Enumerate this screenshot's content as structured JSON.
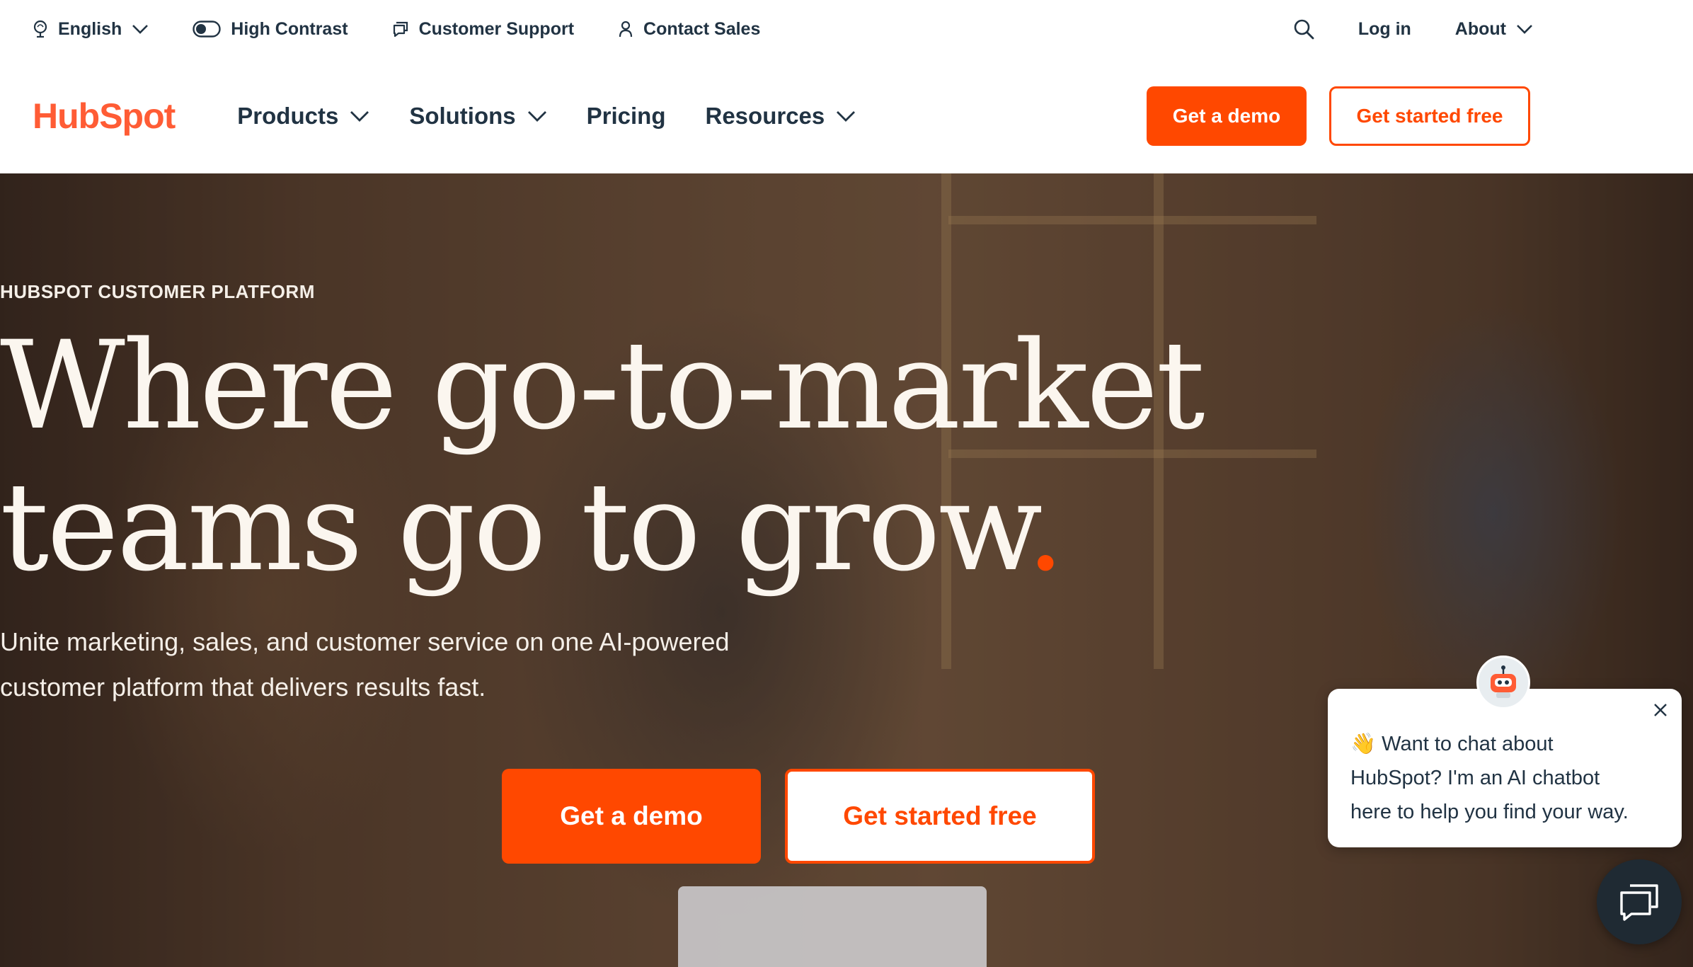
{
  "utility_bar": {
    "language": "English",
    "high_contrast": "High Contrast",
    "customer_support": "Customer Support",
    "contact_sales": "Contact Sales",
    "log_in": "Log in",
    "about": "About"
  },
  "nav": {
    "logo": "HubSpot",
    "items": [
      {
        "label": "Products",
        "has_dropdown": true
      },
      {
        "label": "Solutions",
        "has_dropdown": true
      },
      {
        "label": "Pricing",
        "has_dropdown": false
      },
      {
        "label": "Resources",
        "has_dropdown": true
      }
    ],
    "demo_button": "Get a demo",
    "free_button": "Get started free"
  },
  "hero": {
    "eyebrow": "HUBSPOT CUSTOMER PLATFORM",
    "headline_line1": "Where go-to-market",
    "headline_line2": "teams go to grow",
    "headline_dot": ".",
    "subhead_line1": "Unite marketing, sales, and customer service on one AI-powered",
    "subhead_line2": "customer platform that delivers results fast.",
    "demo_button": "Get a demo",
    "free_button": "Get started free"
  },
  "chat": {
    "line1": "👋 Want to chat about",
    "line2": "HubSpot? I'm an AI chatbot",
    "line3": "here to help you find your way."
  },
  "colors": {
    "brand_orange": "#ff4800",
    "logo_orange": "#ff5c35",
    "text_dark": "#213343",
    "hero_text": "#fbf6ef"
  },
  "icons": [
    "globe-icon",
    "toggle-icon",
    "chat-bubble-icon",
    "person-icon",
    "search-icon",
    "chevron-down-icon",
    "close-icon",
    "bot-icon",
    "chat-launcher-icon"
  ]
}
